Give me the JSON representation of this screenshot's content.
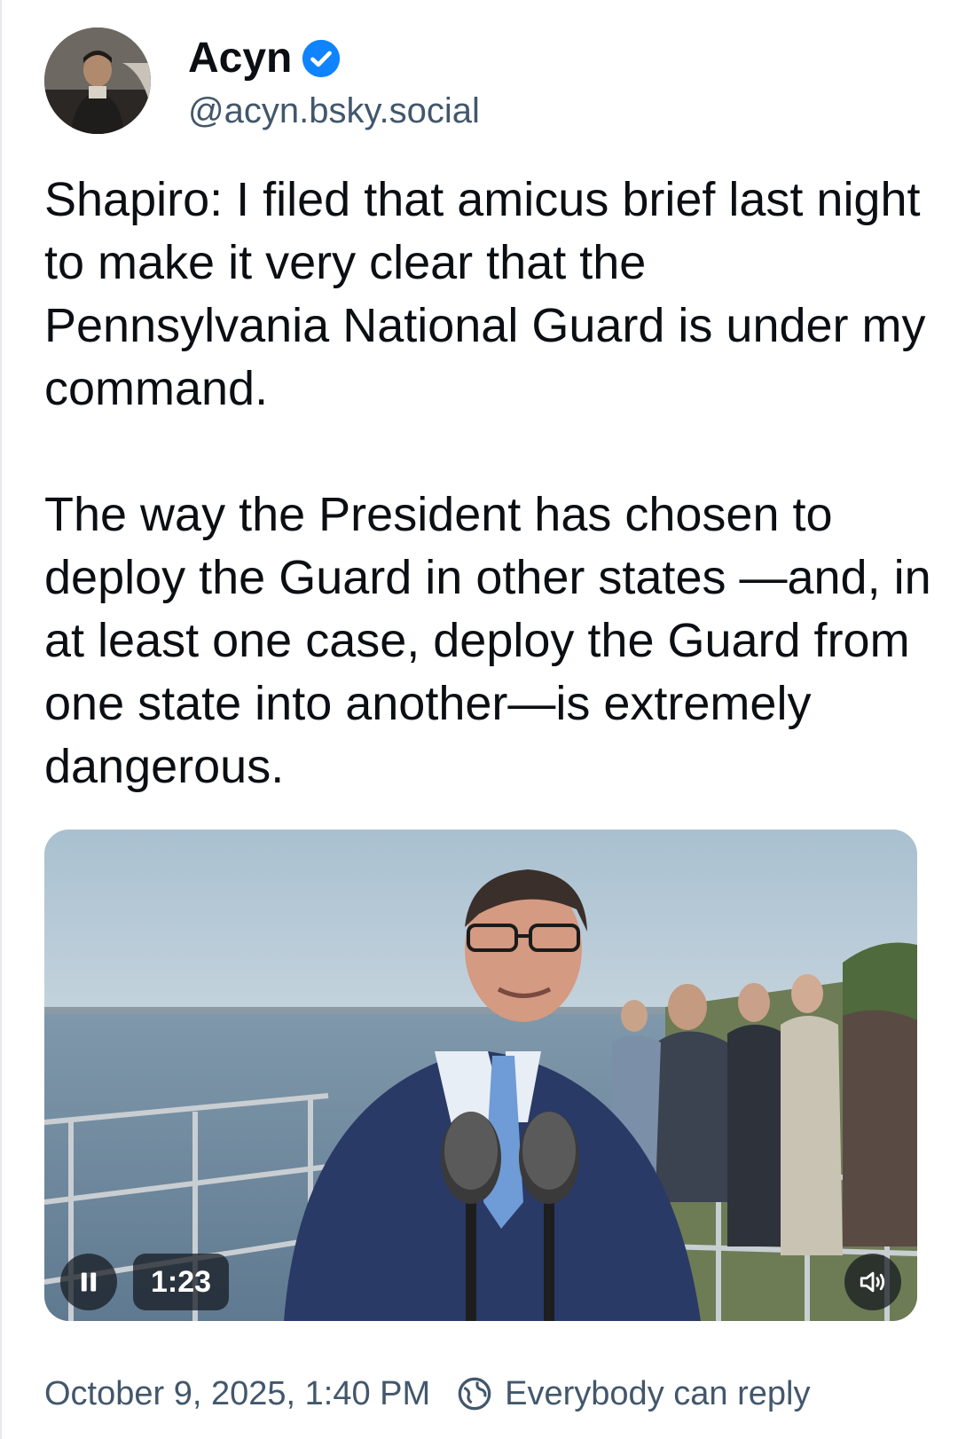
{
  "author": {
    "display_name": "Acyn",
    "handle": "@acyn.bsky.social",
    "verified_icon": "verified-check-icon",
    "badge_color": "#1083fe"
  },
  "post": {
    "paragraphs": [
      "Shapiro: I filed that amicus brief last night to make it very clear that the Pennsylvania National Guard is under my command.",
      "The way the President has chosen to deploy the Guard in other states —and, in at least one case, deploy the Guard from one state into another—is extremely dangerous."
    ]
  },
  "video": {
    "duration": "1:23",
    "state": "playing",
    "controls": {
      "pause_icon": "pause-icon",
      "mute_icon": "speaker-icon"
    }
  },
  "footer": {
    "timestamp": "October 9, 2025, 1:40 PM",
    "reply_setting": "Everybody can reply",
    "reply_icon": "globe-icon"
  },
  "colors": {
    "text": "#0b0f14",
    "muted": "#42576c"
  }
}
